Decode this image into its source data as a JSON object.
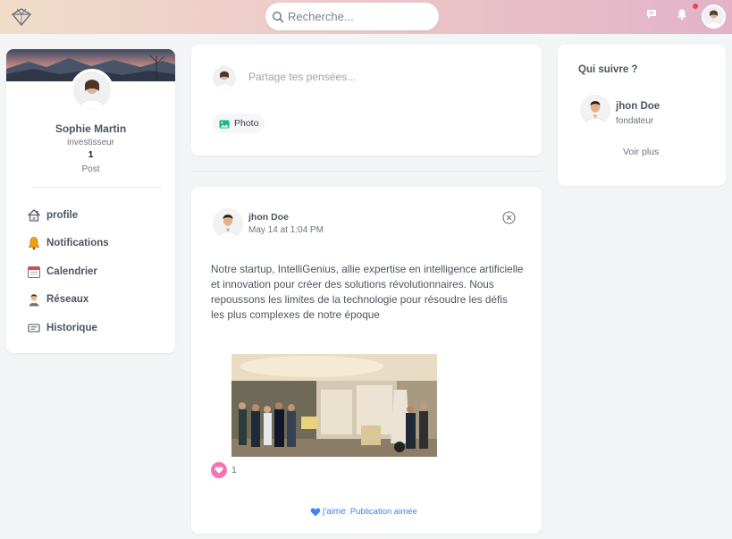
{
  "header": {
    "search_placeholder": "Recherche...",
    "notification_dot_color": "#ef4444",
    "icons": [
      "diamond-logo-icon",
      "search-icon",
      "chat-icon",
      "bell-icon"
    ]
  },
  "profile": {
    "name": "Sophie Martin",
    "role": "investisseur",
    "post_count": "1",
    "post_label": "Post"
  },
  "sidebar": {
    "items": [
      {
        "label": "profile",
        "icon": "house-icon"
      },
      {
        "label": "Notifications",
        "icon": "bell-icon"
      },
      {
        "label": "Calendrier",
        "icon": "calendar-icon"
      },
      {
        "label": "Réseaux",
        "icon": "person-icon"
      },
      {
        "label": "Historique",
        "icon": "history-icon"
      }
    ]
  },
  "composer": {
    "placeholder": "Partage tes pensées...",
    "photo_label": "Photo"
  },
  "post": {
    "author": "jhon Doe",
    "time": "May 14 at 1:04 PM",
    "text": "Notre startup, IntelliGenius, allie expertise en intelligence artificielle et innovation pour créer des solutions révolutionnaires. Nous repoussons les limites de la technologie pour résoudre les défis les plus complexes de notre époque",
    "like_count": "1",
    "like_label": "j'aime",
    "liked_label": "Publication aimée"
  },
  "suggestions": {
    "title": "Qui suivre ?",
    "items": [
      {
        "name": "jhon Doe",
        "role": "fondateur"
      }
    ],
    "more_label": "Voir plus"
  },
  "colors": {
    "accent": "#3b82f6",
    "like": "#f472b6",
    "photo_icon": "#10b981"
  }
}
